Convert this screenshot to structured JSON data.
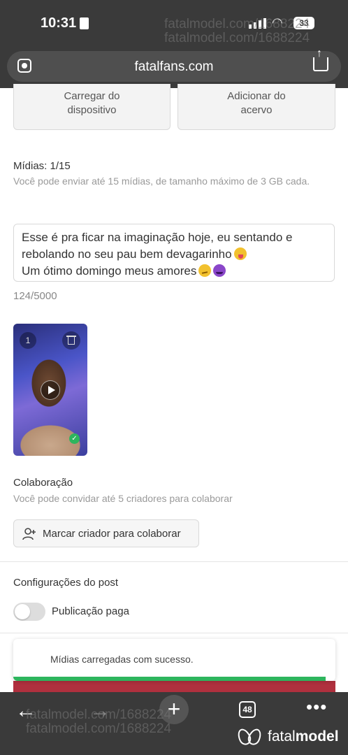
{
  "status_bar": {
    "time": "10:31",
    "battery": "33"
  },
  "browser": {
    "url": "fatalfans.com",
    "tabs_count": "48"
  },
  "watermark": "fatalmodel.com/1688224",
  "upload": {
    "device_label": "Carregar do dispositivo",
    "library_label": "Adicionar do acervo"
  },
  "media": {
    "title": "Mídias: 1/15",
    "hint": "Você pode enviar até 15 mídias, de tamanho máximo de 3 GB cada.",
    "thumb_index": "1"
  },
  "caption": {
    "line1": "Esse é pra ficar na imaginação hoje, eu sentando e",
    "line2": "rebolando no seu pau bem devagarinho",
    "line3": "Um ótimo domingo meus amores",
    "counter": "124/5000"
  },
  "collaboration": {
    "title": "Colaboração",
    "hint": "Você pode convidar até 5 criadores para colaborar",
    "button_label": "Marcar criador para colaborar"
  },
  "post_settings": {
    "title": "Configurações do post",
    "paid_label": "Publicação paga",
    "paid_enabled": false
  },
  "toast": {
    "message": "Mídias carregadas com sucesso.",
    "progress": 0.97
  },
  "brand": {
    "name_light": "fatal",
    "name_bold": "model"
  },
  "icons": {
    "lens": "google-lens-icon",
    "share": "share-icon",
    "trash": "trash-icon",
    "play": "play-icon",
    "check": "check-icon",
    "add_person": "add-person-icon",
    "back": "arrow-left-icon",
    "forward": "arrow-right-icon",
    "new_tab": "plus-icon",
    "more": "more-icon"
  }
}
